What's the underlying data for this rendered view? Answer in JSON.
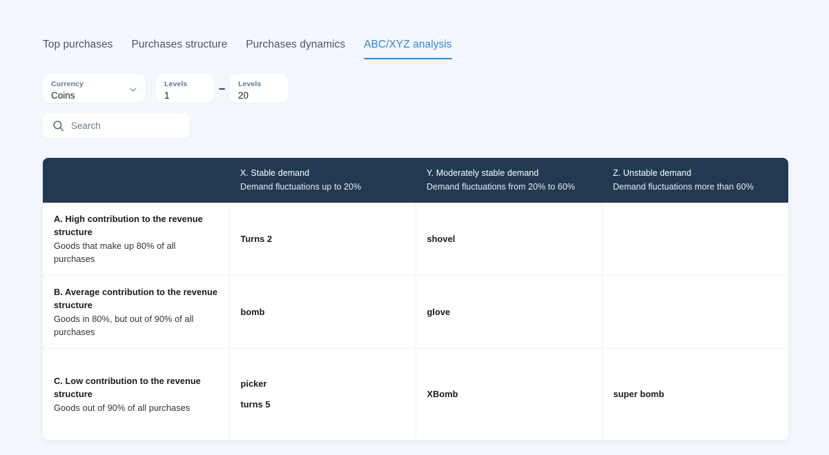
{
  "theme": {
    "background": "#f4f7fe",
    "accent": "#2f87d8",
    "header_bg": "#213a52",
    "surface": "#ffffff",
    "grid_line": "#eef0f3"
  },
  "tabs": [
    {
      "label": "Top purchases",
      "active": false
    },
    {
      "label": "Purchases structure",
      "active": false
    },
    {
      "label": "Purchases dynamics",
      "active": false
    },
    {
      "label": "ABC/XYZ analysis",
      "active": true
    }
  ],
  "filters": {
    "currency": {
      "label": "Currency",
      "value": "Coins",
      "icon": "chevron-down-icon"
    },
    "level_from": {
      "label": "Levels",
      "value": "1"
    },
    "separator": "-",
    "level_to": {
      "label": "Levels",
      "value": "20"
    }
  },
  "search": {
    "icon": "search-icon",
    "placeholder": "Search",
    "value": ""
  },
  "matrix": {
    "corner_header": "",
    "columns": [
      {
        "title": "X. Stable demand",
        "subtitle": "Demand fluctuations up to 20%"
      },
      {
        "title": "Y. Moderately stable demand",
        "subtitle": "Demand fluctuations from 20% to 60%"
      },
      {
        "title": "Z. Unstable demand",
        "subtitle": "Demand fluctuations more than 60%"
      }
    ],
    "rows": [
      {
        "title": "A. High contribution to the revenue structure",
        "subtitle": "Goods that make up 80% of all purchases",
        "cells": [
          {
            "items": [
              "Turns 2"
            ]
          },
          {
            "items": [
              "shovel"
            ]
          },
          {
            "items": []
          }
        ]
      },
      {
        "title": "B. Average contribution to the revenue structure",
        "subtitle": "Goods in 80%, but out of 90% of all purchases",
        "cells": [
          {
            "items": [
              "bomb"
            ]
          },
          {
            "items": [
              "glove"
            ]
          },
          {
            "items": []
          }
        ]
      },
      {
        "title": "C. Low contribution to the revenue structure",
        "subtitle": "Goods out of 90% of all purchases",
        "cells": [
          {
            "items": [
              "picker",
              "turns 5"
            ]
          },
          {
            "items": [
              "XBomb"
            ]
          },
          {
            "items": [
              "super bomb"
            ]
          }
        ]
      }
    ]
  }
}
